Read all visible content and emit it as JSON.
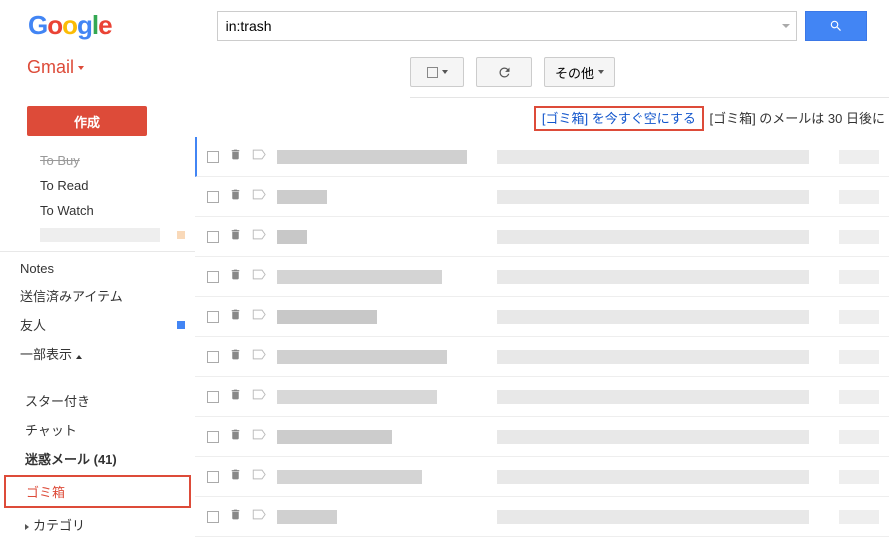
{
  "header": {
    "search_value": "in:trash"
  },
  "gmail_label": "Gmail",
  "toolbar": {
    "other_label": "その他"
  },
  "sidebar": {
    "compose_label": "作成",
    "items": {
      "to_buy": "To Buy",
      "to_read": "To Read",
      "to_watch": "To Watch",
      "notes": "Notes",
      "sent_items": "送信済みアイテム",
      "friends": "友人",
      "show_partial": "一部表示",
      "starred": "スター付き",
      "chat": "チャット",
      "spam": "迷惑メール (41)",
      "trash": "ゴミ箱",
      "category": "カテゴリ"
    }
  },
  "banner": {
    "empty_trash_link": "[ゴミ箱] を今すぐ空にする",
    "info_text": "[ゴミ箱] のメールは 30 日後に"
  },
  "rows": [
    {
      "sender_w": 190,
      "sender_bg": "#d0d0d0"
    },
    {
      "sender_w": 50,
      "sender_bg": "#ccc"
    },
    {
      "sender_w": 30,
      "sender_bg": "#c8c8c8"
    },
    {
      "sender_w": 165,
      "sender_bg": "#d4d4d4"
    },
    {
      "sender_w": 100,
      "sender_bg": "#c8c8c8"
    },
    {
      "sender_w": 170,
      "sender_bg": "#d0d0d0"
    },
    {
      "sender_w": 160,
      "sender_bg": "#d8d8d8"
    },
    {
      "sender_w": 115,
      "sender_bg": "#ccc"
    },
    {
      "sender_w": 145,
      "sender_bg": "#d4d4d4"
    },
    {
      "sender_w": 60,
      "sender_bg": "#d0d0d0"
    }
  ]
}
